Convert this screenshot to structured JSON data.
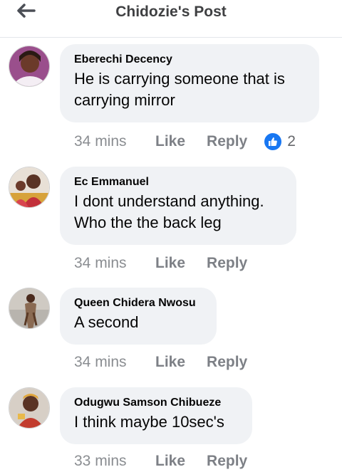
{
  "header": {
    "title": "Chidozie's Post"
  },
  "actions": {
    "like_label": "Like",
    "reply_label": "Reply"
  },
  "colors": {
    "bubble": "#f0f2f5",
    "like_blue": "#1877f2",
    "meta_gray": "#8a8d91"
  },
  "comments": [
    {
      "name": "Eberechi Decency",
      "text_lines": [
        "He is carrying someone that is",
        "carrying mirror"
      ],
      "time": "34 mins",
      "reactions": {
        "icon": "like-reaction-icon",
        "count": "2"
      }
    },
    {
      "name": "Ec Emmanuel",
      "text_lines": [
        "I dont understand anything.",
        "Who the the back leg"
      ],
      "time": "34 mins"
    },
    {
      "name": "Queen Chidera Nwosu",
      "text_lines": [
        "A second"
      ],
      "time": "34 mins"
    },
    {
      "name": "Odugwu Samson Chibueze",
      "text_lines": [
        "I think maybe 10sec's"
      ],
      "time": "33 mins"
    }
  ]
}
